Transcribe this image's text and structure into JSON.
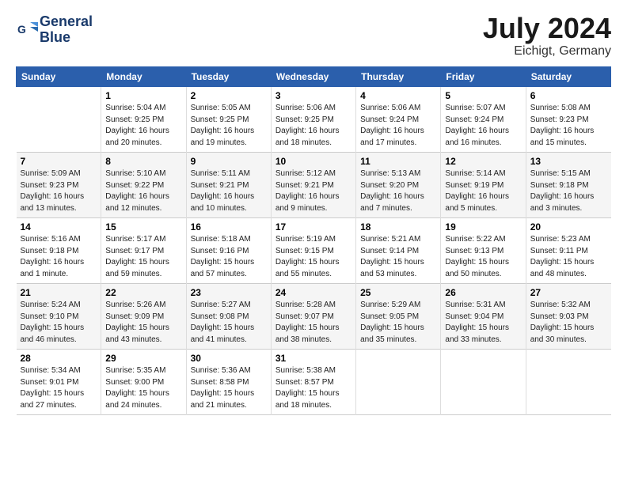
{
  "header": {
    "logo_line1": "General",
    "logo_line2": "Blue",
    "month": "July 2024",
    "location": "Eichigt, Germany"
  },
  "weekdays": [
    "Sunday",
    "Monday",
    "Tuesday",
    "Wednesday",
    "Thursday",
    "Friday",
    "Saturday"
  ],
  "weeks": [
    [
      {
        "day": "",
        "info": ""
      },
      {
        "day": "1",
        "info": "Sunrise: 5:04 AM\nSunset: 9:25 PM\nDaylight: 16 hours\nand 20 minutes."
      },
      {
        "day": "2",
        "info": "Sunrise: 5:05 AM\nSunset: 9:25 PM\nDaylight: 16 hours\nand 19 minutes."
      },
      {
        "day": "3",
        "info": "Sunrise: 5:06 AM\nSunset: 9:25 PM\nDaylight: 16 hours\nand 18 minutes."
      },
      {
        "day": "4",
        "info": "Sunrise: 5:06 AM\nSunset: 9:24 PM\nDaylight: 16 hours\nand 17 minutes."
      },
      {
        "day": "5",
        "info": "Sunrise: 5:07 AM\nSunset: 9:24 PM\nDaylight: 16 hours\nand 16 minutes."
      },
      {
        "day": "6",
        "info": "Sunrise: 5:08 AM\nSunset: 9:23 PM\nDaylight: 16 hours\nand 15 minutes."
      }
    ],
    [
      {
        "day": "7",
        "info": "Sunrise: 5:09 AM\nSunset: 9:23 PM\nDaylight: 16 hours\nand 13 minutes."
      },
      {
        "day": "8",
        "info": "Sunrise: 5:10 AM\nSunset: 9:22 PM\nDaylight: 16 hours\nand 12 minutes."
      },
      {
        "day": "9",
        "info": "Sunrise: 5:11 AM\nSunset: 9:21 PM\nDaylight: 16 hours\nand 10 minutes."
      },
      {
        "day": "10",
        "info": "Sunrise: 5:12 AM\nSunset: 9:21 PM\nDaylight: 16 hours\nand 9 minutes."
      },
      {
        "day": "11",
        "info": "Sunrise: 5:13 AM\nSunset: 9:20 PM\nDaylight: 16 hours\nand 7 minutes."
      },
      {
        "day": "12",
        "info": "Sunrise: 5:14 AM\nSunset: 9:19 PM\nDaylight: 16 hours\nand 5 minutes."
      },
      {
        "day": "13",
        "info": "Sunrise: 5:15 AM\nSunset: 9:18 PM\nDaylight: 16 hours\nand 3 minutes."
      }
    ],
    [
      {
        "day": "14",
        "info": "Sunrise: 5:16 AM\nSunset: 9:18 PM\nDaylight: 16 hours\nand 1 minute."
      },
      {
        "day": "15",
        "info": "Sunrise: 5:17 AM\nSunset: 9:17 PM\nDaylight: 15 hours\nand 59 minutes."
      },
      {
        "day": "16",
        "info": "Sunrise: 5:18 AM\nSunset: 9:16 PM\nDaylight: 15 hours\nand 57 minutes."
      },
      {
        "day": "17",
        "info": "Sunrise: 5:19 AM\nSunset: 9:15 PM\nDaylight: 15 hours\nand 55 minutes."
      },
      {
        "day": "18",
        "info": "Sunrise: 5:21 AM\nSunset: 9:14 PM\nDaylight: 15 hours\nand 53 minutes."
      },
      {
        "day": "19",
        "info": "Sunrise: 5:22 AM\nSunset: 9:13 PM\nDaylight: 15 hours\nand 50 minutes."
      },
      {
        "day": "20",
        "info": "Sunrise: 5:23 AM\nSunset: 9:11 PM\nDaylight: 15 hours\nand 48 minutes."
      }
    ],
    [
      {
        "day": "21",
        "info": "Sunrise: 5:24 AM\nSunset: 9:10 PM\nDaylight: 15 hours\nand 46 minutes."
      },
      {
        "day": "22",
        "info": "Sunrise: 5:26 AM\nSunset: 9:09 PM\nDaylight: 15 hours\nand 43 minutes."
      },
      {
        "day": "23",
        "info": "Sunrise: 5:27 AM\nSunset: 9:08 PM\nDaylight: 15 hours\nand 41 minutes."
      },
      {
        "day": "24",
        "info": "Sunrise: 5:28 AM\nSunset: 9:07 PM\nDaylight: 15 hours\nand 38 minutes."
      },
      {
        "day": "25",
        "info": "Sunrise: 5:29 AM\nSunset: 9:05 PM\nDaylight: 15 hours\nand 35 minutes."
      },
      {
        "day": "26",
        "info": "Sunrise: 5:31 AM\nSunset: 9:04 PM\nDaylight: 15 hours\nand 33 minutes."
      },
      {
        "day": "27",
        "info": "Sunrise: 5:32 AM\nSunset: 9:03 PM\nDaylight: 15 hours\nand 30 minutes."
      }
    ],
    [
      {
        "day": "28",
        "info": "Sunrise: 5:34 AM\nSunset: 9:01 PM\nDaylight: 15 hours\nand 27 minutes."
      },
      {
        "day": "29",
        "info": "Sunrise: 5:35 AM\nSunset: 9:00 PM\nDaylight: 15 hours\nand 24 minutes."
      },
      {
        "day": "30",
        "info": "Sunrise: 5:36 AM\nSunset: 8:58 PM\nDaylight: 15 hours\nand 21 minutes."
      },
      {
        "day": "31",
        "info": "Sunrise: 5:38 AM\nSunset: 8:57 PM\nDaylight: 15 hours\nand 18 minutes."
      },
      {
        "day": "",
        "info": ""
      },
      {
        "day": "",
        "info": ""
      },
      {
        "day": "",
        "info": ""
      }
    ]
  ]
}
